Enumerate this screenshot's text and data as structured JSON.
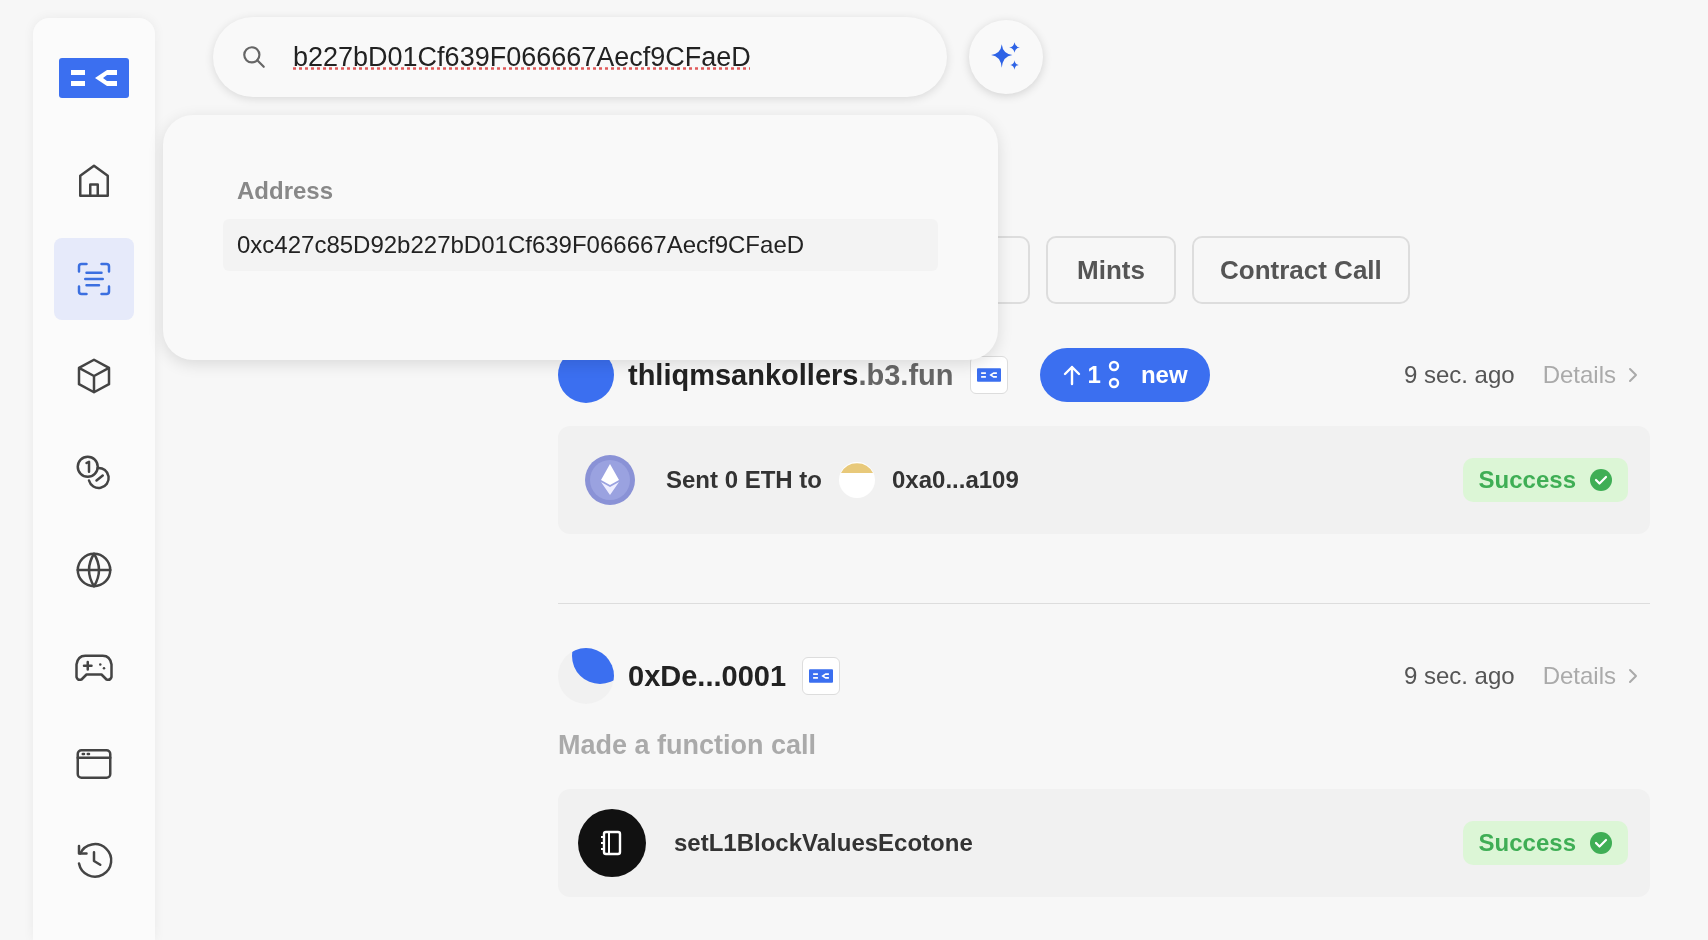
{
  "sidebar": {
    "items": [
      {
        "kind": "home",
        "selected": false
      },
      {
        "kind": "feed",
        "selected": true
      },
      {
        "kind": "cube",
        "selected": false
      },
      {
        "kind": "coins",
        "selected": false
      },
      {
        "kind": "globe",
        "selected": false
      },
      {
        "kind": "gamepad",
        "selected": false
      },
      {
        "kind": "window",
        "selected": false
      },
      {
        "kind": "history",
        "selected": false
      }
    ]
  },
  "search": {
    "value": "b227bD01Cf639F066667Aecf9CFaeD"
  },
  "dropdown": {
    "heading": "Address",
    "results": [
      "0xc427c85D92b227bD01Cf639F066667Aecf9CFaeD"
    ]
  },
  "filters": [
    {
      "label": "Mints",
      "selected": false
    },
    {
      "label": "Contract Call",
      "selected": false
    }
  ],
  "new_pill": {
    "count": "1",
    "label": "new"
  },
  "feed": [
    {
      "avatar": {
        "kind": "plain"
      },
      "name": "thliqmsankollers",
      "name_suffix": ".b3.fun",
      "time": "9 sec. ago",
      "details": "Details",
      "card": {
        "kind": "transfer",
        "text": "Sent 0 ETH to",
        "recipient": "0xa0...a109",
        "status": "Success"
      }
    },
    {
      "avatar": {
        "kind": "capped"
      },
      "name": "0xDe...0001",
      "time": "9 sec. ago",
      "details": "Details",
      "description": "Made a function call",
      "card": {
        "kind": "call",
        "text": "setL1BlockValuesEcotone",
        "status": "Success"
      }
    }
  ]
}
